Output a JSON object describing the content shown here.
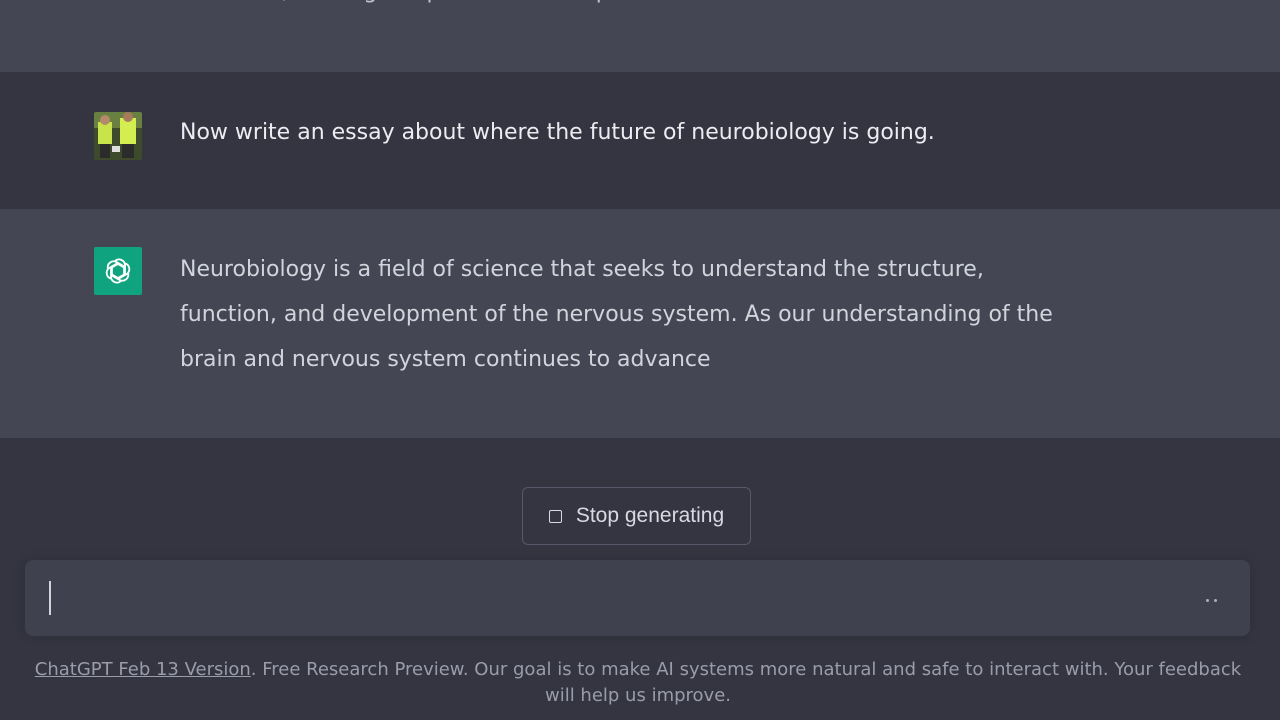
{
  "conversation": {
    "previous_assistant_tail": "disorders, making it a positive and important field for the future.",
    "user_message": "Now write an essay about where the future of neurobiology is going.",
    "assistant_message": "Neurobiology is a field of science that seeks to understand the structure, function, and development of the nervous system. As our understanding of the brain and nervous system continues to advance"
  },
  "icons": {
    "user_avatar": "user-avatar-photo",
    "assistant_avatar": "openai-logo-icon",
    "stop": "stop-square-icon",
    "loading": "typing-dots-icon"
  },
  "controls": {
    "stop_label": "Stop generating",
    "input_value": ""
  },
  "footer": {
    "version_link": "ChatGPT Feb 13 Version",
    "text": ". Free Research Preview. Our goal is to make AI systems more natural and safe to interact with. Your feedback will help us improve."
  },
  "colors": {
    "background": "#343541",
    "assistant_row": "#444654",
    "accent": "#10a37f",
    "input_bg": "#40414f"
  }
}
